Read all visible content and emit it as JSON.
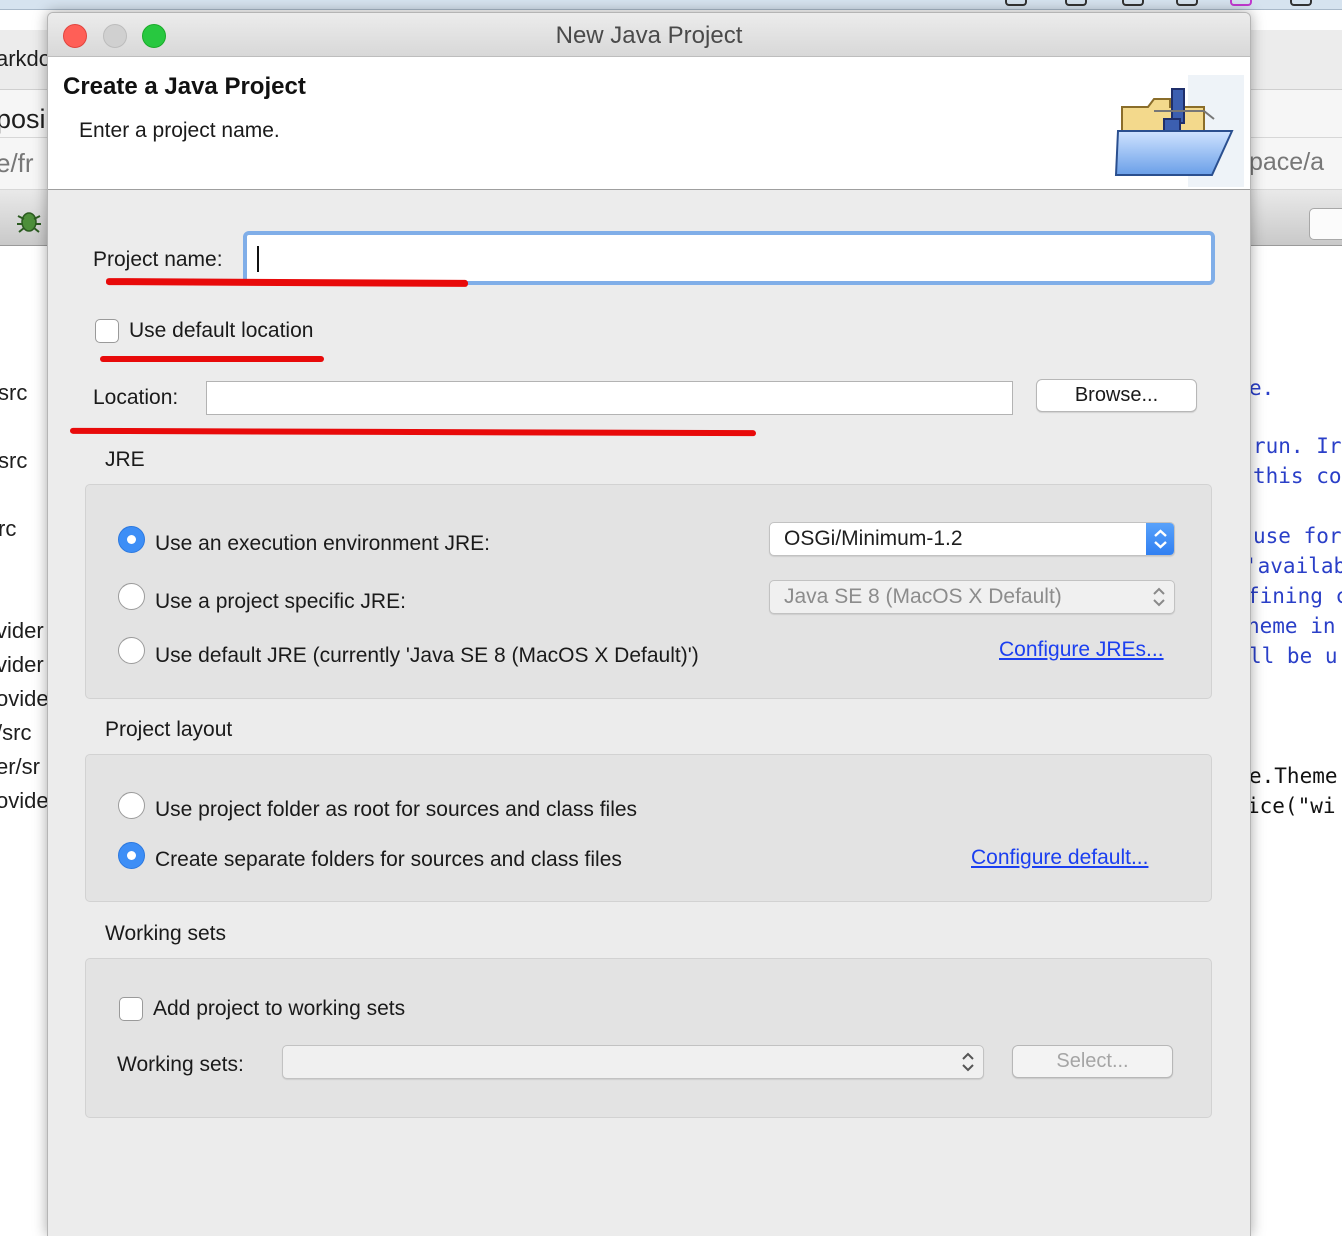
{
  "dialog": {
    "title": "New Java Project",
    "banner": {
      "heading": "Create a Java Project",
      "subheading": "Enter a project name."
    },
    "project_name": {
      "label": "Project name:",
      "value": ""
    },
    "use_default_location": {
      "label": "Use default location",
      "checked": false
    },
    "location": {
      "label": "Location:",
      "value": "",
      "browse_label": "Browse..."
    },
    "jre": {
      "title": "JRE",
      "option_execution_env": "Use an execution environment JRE:",
      "option_project_specific": "Use a project specific JRE:",
      "option_default": "Use default JRE (currently 'Java SE 8 (MacOS X Default)')",
      "selected_option": "execution_env",
      "execution_env_value": "OSGi/Minimum-1.2",
      "project_specific_value": "Java SE 8 (MacOS X Default)",
      "configure_link": "Configure JREs..."
    },
    "project_layout": {
      "title": "Project layout",
      "option_root": "Use project folder as root for sources and class files",
      "option_separate": "Create separate folders for sources and class files",
      "selected_option": "separate",
      "configure_link": "Configure default..."
    },
    "working_sets": {
      "title": "Working sets",
      "add_label": "Add project to working sets",
      "add_checked": false,
      "label": "Working sets:",
      "value": "",
      "select_label": "Select..."
    }
  },
  "background": {
    "left_fragments": [
      "arkdo",
      "posi",
      "e/fr",
      "src",
      "src",
      "rc",
      "vider",
      "vider",
      "ovide",
      "/src",
      "er/sr",
      "ovide"
    ],
    "right_fragments": [
      "pace/a",
      "e.",
      "run. Ir",
      "this co",
      "use for",
      "'availab",
      "fining c",
      "heme in",
      "ll be u",
      "e.Theme",
      "ice(\"wi"
    ]
  },
  "annotations": {
    "underline_color": "#e80a0a"
  }
}
